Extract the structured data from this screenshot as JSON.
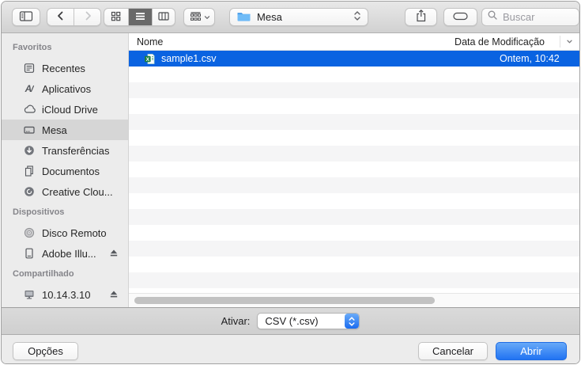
{
  "toolbar": {
    "location": "Mesa",
    "search_placeholder": "Buscar"
  },
  "sidebar": {
    "sections": [
      {
        "label": "Favoritos",
        "items": [
          {
            "icon": "recents-icon",
            "label": "Recentes"
          },
          {
            "icon": "applications-icon",
            "label": "Aplicativos"
          },
          {
            "icon": "icloud-drive-icon",
            "label": "iCloud Drive"
          },
          {
            "icon": "desktop-icon",
            "label": "Mesa",
            "selected": true
          },
          {
            "icon": "downloads-icon",
            "label": "Transferências"
          },
          {
            "icon": "documents-icon",
            "label": "Documentos"
          },
          {
            "icon": "creative-cloud-icon",
            "label": "Creative Clou..."
          }
        ]
      },
      {
        "label": "Dispositivos",
        "items": [
          {
            "icon": "remote-disc-icon",
            "label": "Disco Remoto"
          },
          {
            "icon": "external-drive-icon",
            "label": "Adobe Illu...",
            "ejectable": true
          }
        ]
      },
      {
        "label": "Compartilhado",
        "items": [
          {
            "icon": "network-computer-icon",
            "label": "10.14.3.10",
            "ejectable": true
          }
        ]
      }
    ]
  },
  "file_list": {
    "columns": [
      {
        "label": "Nome"
      },
      {
        "label": "Data de Modificação"
      }
    ],
    "rows": [
      {
        "icon": "excel-file-icon",
        "name": "sample1.csv",
        "modified": "Ontem, 10:42",
        "selected": true
      }
    ]
  },
  "footer": {
    "format_label": "Ativar:",
    "format_value": "CSV (*.csv)",
    "options_button": "Opções",
    "cancel_button": "Cancelar",
    "open_button": "Abrir"
  },
  "colors": {
    "selection_blue": "#0a63e1",
    "primary_button_blue": "#2173f2",
    "folder_blue": "#55a8f0",
    "excel_green": "#1a7e45"
  }
}
